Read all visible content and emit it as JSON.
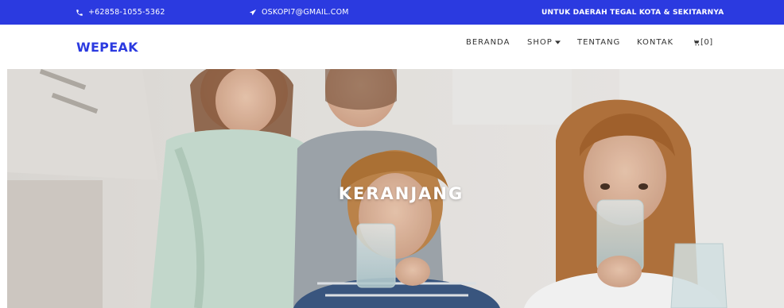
{
  "topbar": {
    "phone": "+62858-1055-5362",
    "email": "OSKOPI7@GMAIL.COM",
    "region": "UNTUK DAERAH TEGAL KOTA & SEKITARNYA",
    "phone_icon": "phone-icon",
    "email_icon": "paper-plane-icon"
  },
  "navbar": {
    "brand": "WEPEAK",
    "items": [
      {
        "label": "BERANDA"
      },
      {
        "label": "SHOP"
      },
      {
        "label": "TENTANG"
      },
      {
        "label": "KONTAK"
      }
    ],
    "cart_count": "[0]",
    "cart_icon": "cart-icon"
  },
  "hero": {
    "title": "KERANJANG"
  },
  "colors": {
    "primary": "#2b3ae0",
    "white": "#ffffff"
  }
}
